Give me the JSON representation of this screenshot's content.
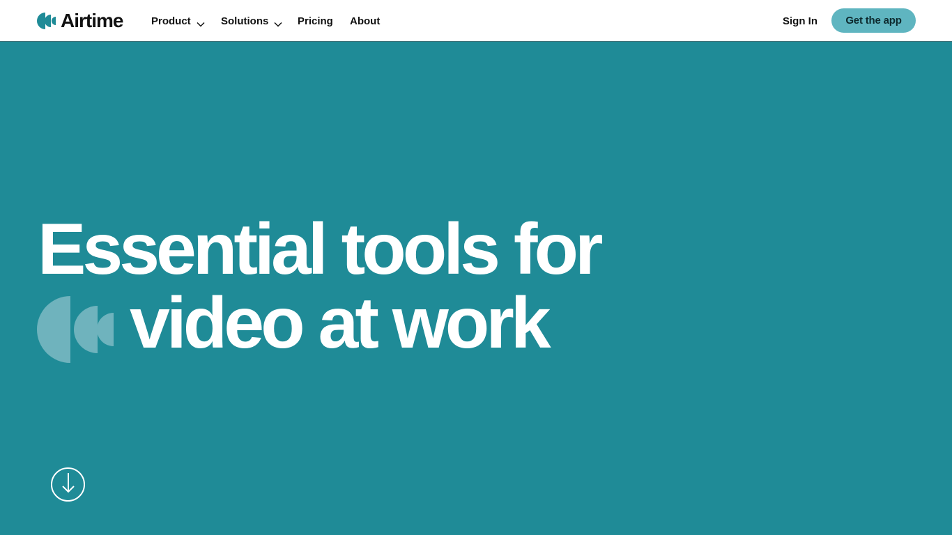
{
  "header": {
    "logo_text": "Airtime",
    "logo_icon": "airtime-mark-icon",
    "nav": {
      "product": "Product",
      "solutions": "Solutions",
      "pricing": "Pricing",
      "about": "About"
    },
    "sign_in": "Sign In",
    "cta": "Get the app"
  },
  "hero": {
    "line1": "Essential tools for",
    "line2": "video at work",
    "mark_icon": "airtime-mark-icon",
    "scroll_icon": "arrow-down-icon"
  },
  "colors": {
    "hero_background": "#1f8b97",
    "brand_teal": "#1f8b97",
    "cta_background": "#5fb5c0",
    "mark_light": "#6fb3bd",
    "text_dark": "#111111",
    "text_light": "#ffffff"
  }
}
